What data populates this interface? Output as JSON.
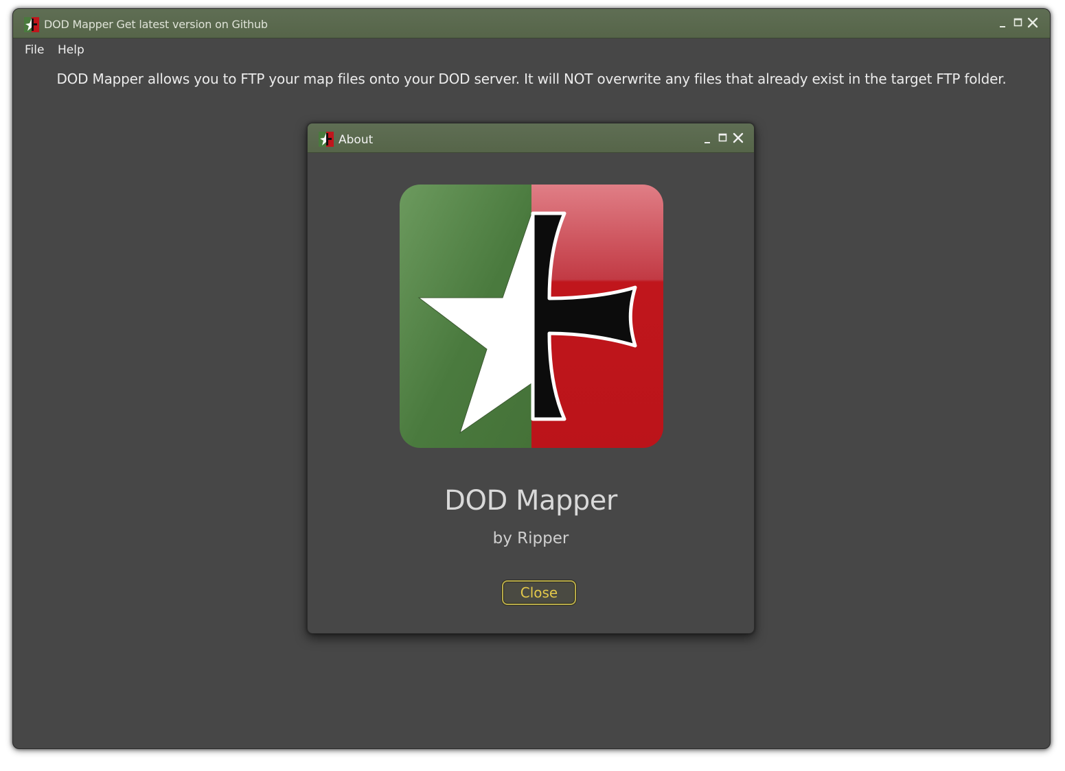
{
  "main_window": {
    "title": "DOD Mapper Get latest version on Github",
    "menu": [
      {
        "label": "File"
      },
      {
        "label": "Help"
      }
    ],
    "description": "DOD Mapper allows you to FTP your map files onto your DOD server. It will NOT overwrite any files that already exist in the target FTP folder."
  },
  "about_dialog": {
    "title": "About",
    "app_name": "DOD Mapper",
    "author": "by Ripper",
    "close_label": "Close"
  },
  "icons": {
    "app": "app-logo-icon",
    "minimize": "minimize-icon",
    "maximize": "maximize-icon",
    "close": "close-icon"
  },
  "colors": {
    "titlebar": "#5a6a4e",
    "window_bg": "#474747",
    "logo_green": "#4a7a3e",
    "logo_red": "#c0161c",
    "close_button_border": "#b8ab4a",
    "close_button_text": "#e4c94a"
  }
}
